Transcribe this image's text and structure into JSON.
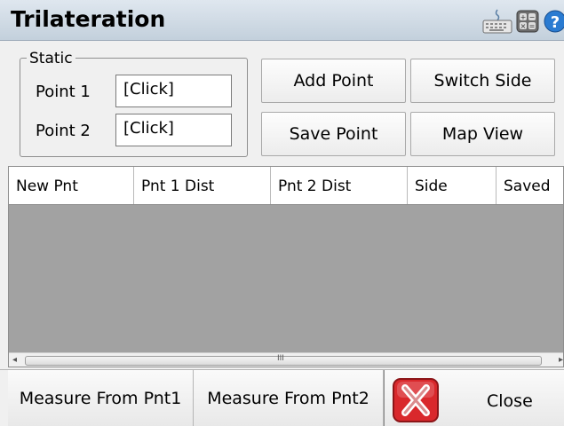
{
  "window": {
    "title": "Trilateration"
  },
  "toolbar": {
    "keyboard_icon": "keyboard-icon",
    "calculator_icon": "calculator-icon",
    "help_icon": "help-icon"
  },
  "static_group": {
    "legend": "Static",
    "point1": {
      "label": "Point 1",
      "value": "[Click]"
    },
    "point2": {
      "label": "Point 2",
      "value": "[Click]"
    }
  },
  "buttons": {
    "add_point": "Add Point",
    "switch_side": "Switch Side",
    "save_point": "Save Point",
    "map_view": "Map View"
  },
  "table": {
    "columns": [
      "New Pnt",
      "Pnt 1 Dist",
      "Pnt 2 Dist",
      "Side",
      "Saved"
    ],
    "rows": [],
    "scroll_grip": "III"
  },
  "bottom_bar": {
    "measure_from_pnt1": "Measure From Pnt1",
    "measure_from_pnt2": "Measure From Pnt2",
    "close": "Close"
  },
  "colors": {
    "close_icon": "#d9282c",
    "grid_background": "#a2a2a2",
    "title_bar": "#cfdae5"
  }
}
